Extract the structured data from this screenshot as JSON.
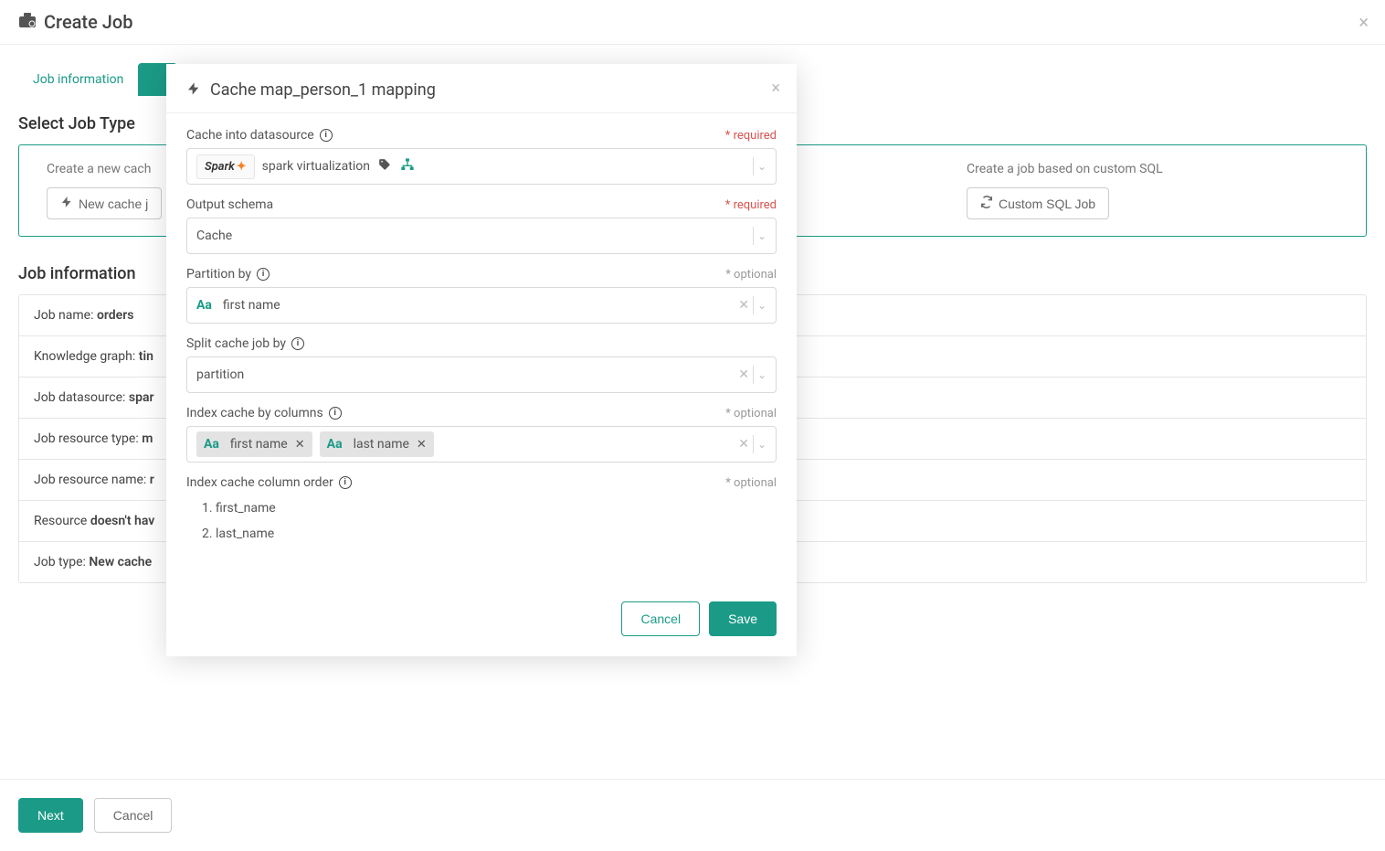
{
  "header": {
    "title": "Create Job"
  },
  "tabs": {
    "job_info": "Job information"
  },
  "section": {
    "select_type": "Select Job Type",
    "left_desc": "Create a new cach",
    "right_desc": "Create a job based on custom SQL",
    "new_cache_btn": "New cache j",
    "custom_sql_btn": "Custom SQL Job"
  },
  "job_info": {
    "title": "Job information",
    "rows": [
      {
        "label": "Job name: ",
        "value": "orders"
      },
      {
        "label": "Knowledge graph: ",
        "value": "tin"
      },
      {
        "label": "Job datasource: ",
        "value": "spar"
      },
      {
        "label": "Job resource type: ",
        "value": "m"
      },
      {
        "label": "Job resource name: ",
        "value": "r"
      },
      {
        "label": "Resource ",
        "value": "doesn't hav"
      },
      {
        "label": "Job type: ",
        "value": "New cache"
      }
    ]
  },
  "footer": {
    "next": "Next",
    "cancel": "Cancel"
  },
  "modal": {
    "title": "Cache map_person_1 mapping",
    "cache_into_label": "Cache into datasource",
    "required": "* required",
    "optional": "* optional",
    "ds_value": "spark virtualization",
    "schema_label": "Output schema",
    "schema_value": "Cache",
    "partition_label": "Partition by",
    "partition_value": "first name",
    "split_label": "Split cache job by",
    "split_value": "partition",
    "index_cols_label": "Index cache by columns",
    "chip_first": "first name",
    "chip_last": "last name",
    "order_label": "Index cache column order",
    "order1": "first_name",
    "order2": "last_name",
    "cancel": "Cancel",
    "save": "Save"
  }
}
